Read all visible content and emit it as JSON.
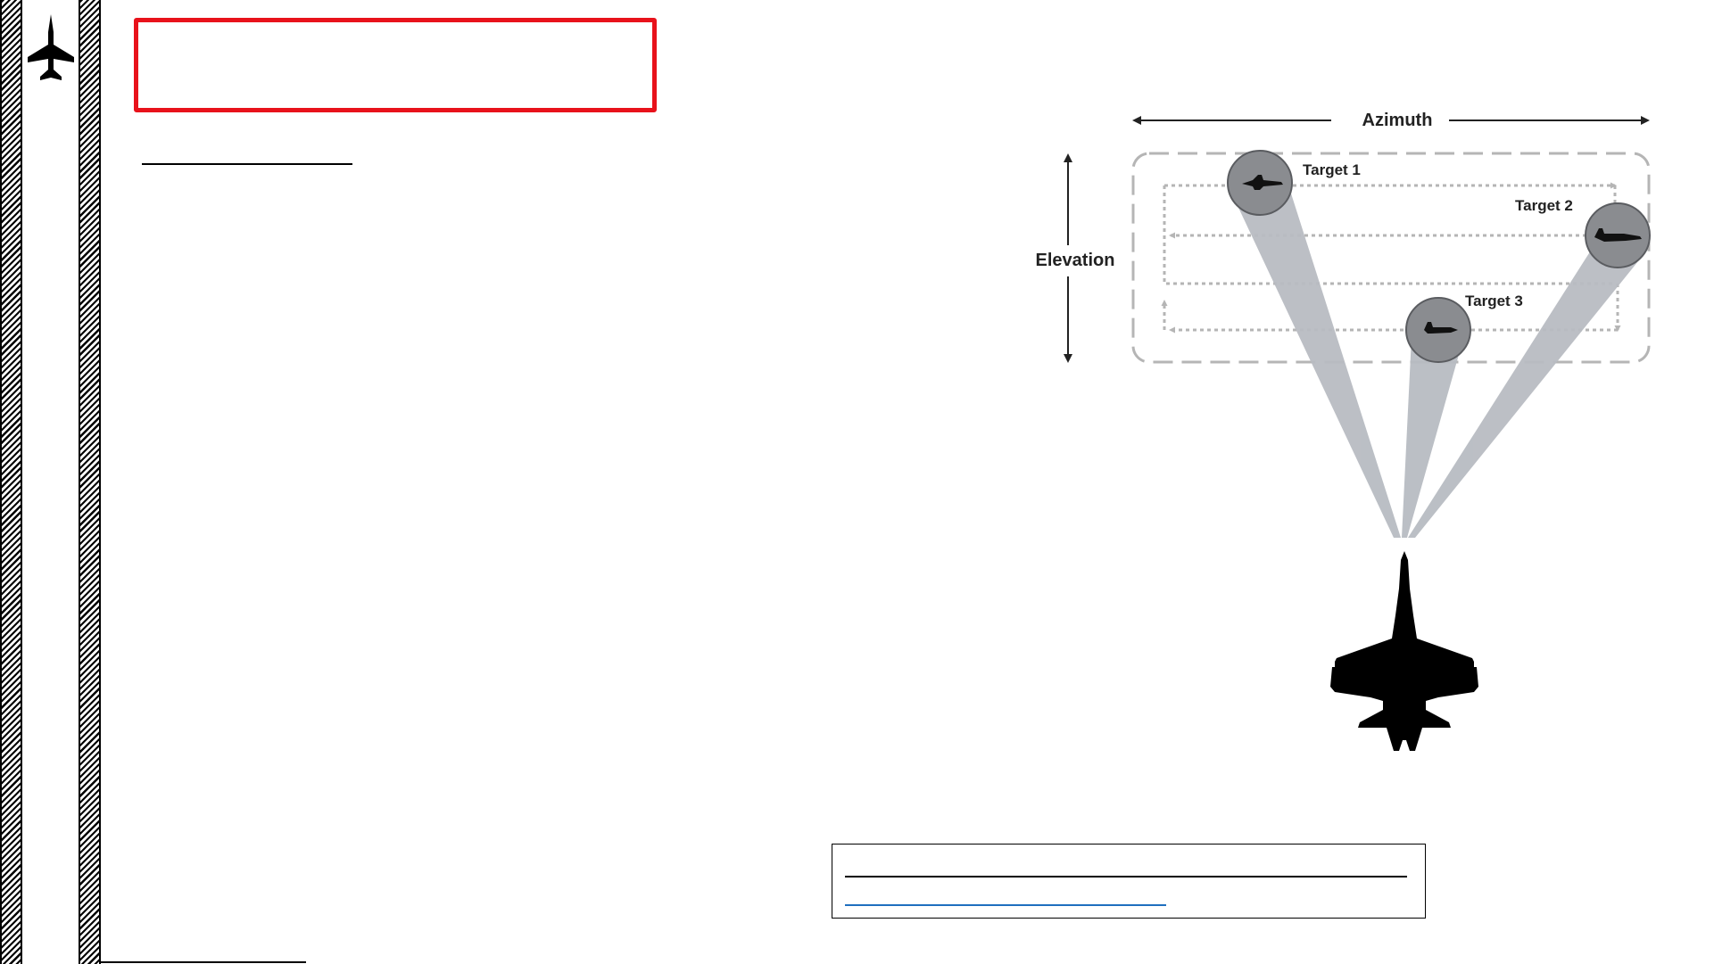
{
  "slide": {
    "title": "",
    "sidebar_icon": "fighter-jet-icon"
  },
  "diagram": {
    "azimuth_label": "Azimuth",
    "elevation_label": "Elevation",
    "targets": [
      {
        "label": "Target 1"
      },
      {
        "label": "Target 2"
      },
      {
        "label": "Target 3"
      }
    ],
    "colors": {
      "scan_box": "#b5b5b5",
      "beam": "#b8bcc2",
      "target_circle": "#8a8c90",
      "aircraft": "#000000",
      "title_border": "#e8121b",
      "link": "#1f6fbf"
    }
  },
  "caption": {
    "text": "",
    "link_text": ""
  }
}
